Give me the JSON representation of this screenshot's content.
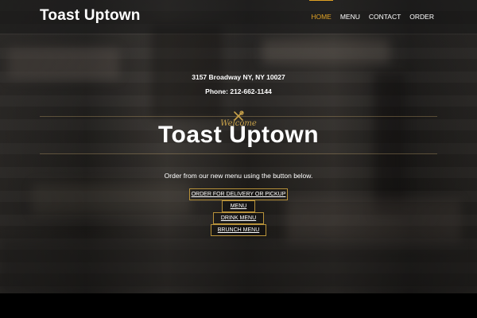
{
  "site": {
    "brand": "Toast Uptown"
  },
  "nav": {
    "items": [
      {
        "label": "HOME",
        "active": true
      },
      {
        "label": "MENU",
        "active": false
      },
      {
        "label": "CONTACT",
        "active": false
      },
      {
        "label": "ORDER",
        "active": false
      }
    ]
  },
  "hero": {
    "address": "3157 Broadway NY, NY 10027",
    "phone": "Phone: 212-662-1144",
    "welcome": "Welcome",
    "title": "Toast Uptown",
    "lead": "Order from our new menu using the button below.",
    "buttons": {
      "order": "ORDER FOR DELIVERY OR PICKUP",
      "menu": "MENU",
      "drink": "DRINK MENU",
      "brunch": "BRUNCH MENU"
    }
  },
  "colors": {
    "accent": "#e0a225",
    "button_border": "#b8923a",
    "welcome": "#c9a24a"
  },
  "icons": {
    "divider": "utensils-icon"
  }
}
